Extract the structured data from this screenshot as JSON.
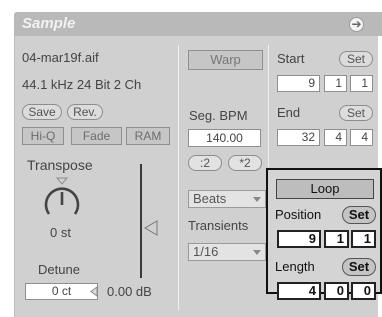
{
  "title": "Sample",
  "title_button_glyph": "➔",
  "file": {
    "name": "04-mar19f.aif",
    "info": "44.1 kHz 24 Bit 2 Ch",
    "save_label": "Save",
    "rev_label": "Rev.",
    "hiq_label": "Hi-Q",
    "fade_label": "Fade",
    "ram_label": "RAM"
  },
  "transpose": {
    "label": "Transpose",
    "value": "0 st"
  },
  "detune": {
    "label": "Detune",
    "value": "0 ct"
  },
  "volume": {
    "value": "0.00 dB"
  },
  "warp": {
    "warp_label": "Warp",
    "seg_bpm_label": "Seg. BPM",
    "seg_bpm_value": "140.00",
    "half_label": ":2",
    "double_label": "*2",
    "mode_value": "Beats",
    "transients_label": "Transients",
    "transients_value": "1/16"
  },
  "start": {
    "label": "Start",
    "set_label": "Set",
    "values": [
      "9",
      "1",
      "1"
    ]
  },
  "end": {
    "label": "End",
    "set_label": "Set",
    "values": [
      "32",
      "4",
      "4"
    ]
  },
  "loop": {
    "toggle_label": "Loop",
    "position_label": "Position",
    "position_set_label": "Set",
    "position_values": [
      "9",
      "1",
      "1"
    ],
    "length_label": "Length",
    "length_set_label": "Set",
    "length_values": [
      "4",
      "0",
      "0"
    ]
  }
}
